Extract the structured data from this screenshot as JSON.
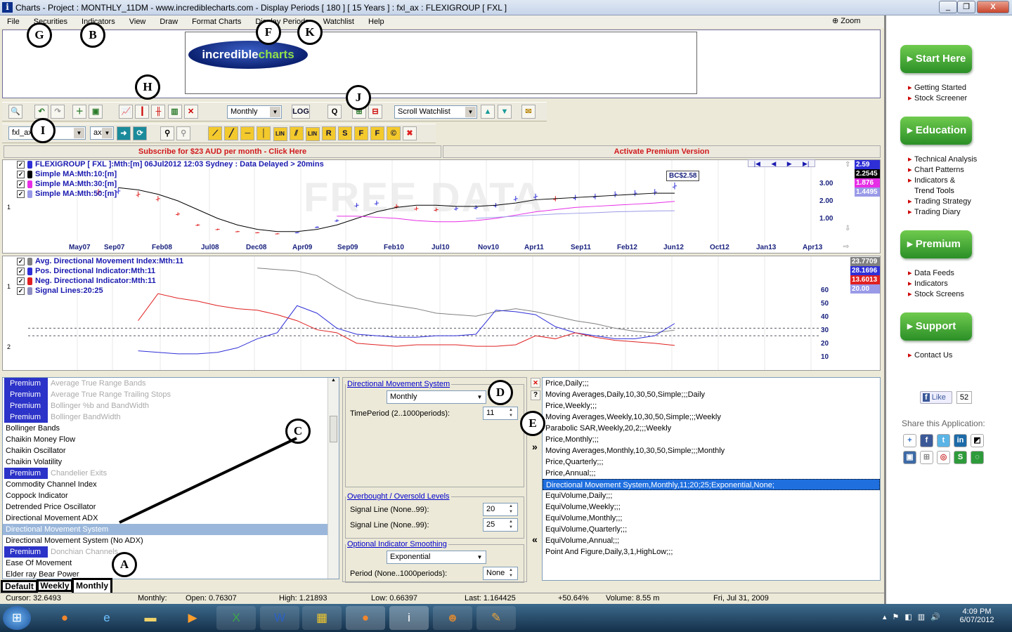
{
  "window": {
    "title": "Charts - Project : MONTHLY_11DM - www.incrediblecharts.com - Display Periods  [ 180 ]  [ 15 Years ] : fxl_ax : FLEXIGROUP  [ FXL ]",
    "icon_glyph": "i",
    "min": "_",
    "max": "❐",
    "close": "X"
  },
  "menu": {
    "items": [
      "File",
      "Securities",
      "Indicators",
      "View",
      "Draw",
      "Format Charts",
      "Display Periods",
      "Watchlist",
      "Help"
    ],
    "zoom": "Zoom"
  },
  "logo": {
    "left": "incredible",
    "right": "charts"
  },
  "toolbar1": {
    "period": "Monthly",
    "log": "LOG",
    "watchlist": "Scroll Watchlist"
  },
  "toolbar2": {
    "symbol": "fxl_ax",
    "exchange": "ax"
  },
  "banners": {
    "subscribe": "Subscribe for $23 AUD per month - Click Here",
    "activate": "Activate Premium Version"
  },
  "price_chart": {
    "watermark": "FREE DATA",
    "legend": [
      {
        "text": "FLEXIGROUP [ FXL ]:Mth:[m]  06Jul2012 12:03 Sydney : Data Delayed > 20mins",
        "color": "#2f2fd8"
      },
      {
        "text": "Simple MA:Mth:10:[m]",
        "color": "#000000"
      },
      {
        "text": "Simple MA:Mth:30:[m]",
        "color": "#e62ee6"
      },
      {
        "text": "Simple MA:Mth:50:[m]",
        "color": "#9a9ae8"
      }
    ],
    "badges": [
      {
        "v": "2.59",
        "c": "#2f2fd8"
      },
      {
        "v": "2.2545",
        "c": "#000000"
      },
      {
        "v": "1.876",
        "c": "#e62ee6"
      },
      {
        "v": "1.4495",
        "c": "#9a9ae8"
      }
    ],
    "callout": "BC$2.58",
    "pane_num": "1",
    "x_labels": [
      "May07",
      "Sep07",
      "Feb08",
      "Jul08",
      "Dec08",
      "Apr09",
      "Sep09",
      "Feb10",
      "Jul10",
      "Nov10",
      "Apr11",
      "Sep11",
      "Feb12",
      "Jun12",
      "Oct12",
      "Jan13",
      "Apr13"
    ],
    "y_labels": [
      "3.00",
      "2.00",
      "1.00"
    ],
    "nav": [
      "|◀",
      "◀",
      "▶",
      "▶|"
    ]
  },
  "dmi_chart": {
    "legend": [
      {
        "text": "Avg. Directional Movement Index:Mth:11",
        "color": "#808080"
      },
      {
        "text": "Pos. Directional Indicator:Mth:11",
        "color": "#2f2fd8"
      },
      {
        "text": "Neg. Directional Indicator:Mth:11",
        "color": "#e02020"
      },
      {
        "text": "Signal Lines:20:25",
        "color": "#8d8dbf"
      }
    ],
    "badges": [
      {
        "v": "23.7709",
        "c": "#808080"
      },
      {
        "v": "28.1696",
        "c": "#2f2fd8"
      },
      {
        "v": "13.6013",
        "c": "#e02020"
      },
      {
        "v": "20.00",
        "c": "#9a9ae8"
      }
    ],
    "pane_nums": [
      "1",
      "2"
    ],
    "y_labels": [
      "60",
      "50",
      "40",
      "30",
      "20",
      "10"
    ]
  },
  "chart_data": {
    "type": "line",
    "title": "FLEXIGROUP [ FXL ]",
    "x_ticks": [
      "May07",
      "Sep07",
      "Feb08",
      "Jul08",
      "Dec08",
      "Apr09",
      "Sep09",
      "Feb10",
      "Jul10",
      "Nov10",
      "Apr11",
      "Sep11",
      "Feb12",
      "Jun12",
      "Oct12",
      "Jan13",
      "Apr13"
    ],
    "price_ylim": [
      0.3,
      3.5
    ],
    "price_series": [
      {
        "name": "Price",
        "values": [
          2.3,
          2.35,
          2.2,
          2.0,
          1.3,
          0.8,
          0.6,
          0.5,
          0.45,
          0.4,
          0.45,
          0.7,
          1.0,
          1.7,
          1.8,
          1.65,
          1.55,
          1.5,
          1.55,
          1.6,
          1.7,
          2.0,
          2.1,
          2.0,
          2.05,
          2.1,
          2.2,
          2.25,
          2.3,
          2.58
        ]
      },
      {
        "name": "Simple MA:Mth:10",
        "values": [
          null,
          2.5,
          2.4,
          2.2,
          1.9,
          1.5,
          1.1,
          0.8,
          0.6,
          0.5,
          0.5,
          0.6,
          0.8,
          1.1,
          1.4,
          1.6,
          1.7,
          1.7,
          1.65,
          1.65,
          1.7,
          1.8,
          1.95,
          2.0,
          2.05,
          2.1,
          2.15,
          2.2,
          2.25,
          2.25
        ]
      },
      {
        "name": "Simple MA:Mth:30",
        "values": [
          null,
          null,
          null,
          null,
          null,
          null,
          null,
          null,
          null,
          null,
          null,
          null,
          1.2,
          1.2,
          1.15,
          1.1,
          1.0,
          0.95,
          0.95,
          1.0,
          1.1,
          1.25,
          1.4,
          1.5,
          1.6,
          1.65,
          1.7,
          1.75,
          1.8,
          1.876
        ]
      },
      {
        "name": "Simple MA:Mth:50",
        "values": [
          null,
          null,
          null,
          null,
          null,
          null,
          null,
          null,
          null,
          null,
          null,
          null,
          null,
          null,
          null,
          null,
          null,
          null,
          null,
          1.1,
          1.15,
          1.2,
          1.25,
          1.3,
          1.33,
          1.36,
          1.4,
          1.42,
          1.44,
          1.4495
        ]
      }
    ],
    "dmi_ylim": [
      0,
      70
    ],
    "dmi_series": [
      {
        "name": "ADX",
        "values": [
          null,
          null,
          null,
          null,
          null,
          null,
          null,
          null,
          65,
          64,
          63,
          60,
          52,
          45,
          42,
          40,
          38,
          35,
          34,
          33,
          36,
          38,
          36,
          33,
          30,
          28,
          25,
          23,
          22,
          23.77
        ]
      },
      {
        "name": "+DI",
        "values": [
          null,
          null,
          10,
          9,
          8,
          8,
          9,
          12,
          18,
          22,
          40,
          35,
          25,
          21,
          20,
          19,
          19,
          20,
          20,
          21,
          37,
          36,
          34,
          26,
          22,
          20,
          18,
          18,
          20,
          28.17
        ]
      },
      {
        "name": "-DI",
        "values": [
          null,
          null,
          30,
          48,
          45,
          43,
          40,
          38,
          37,
          34,
          30,
          24,
          22,
          15,
          14,
          13,
          14,
          14,
          14,
          13,
          13,
          14,
          20,
          18,
          22,
          19,
          17,
          16,
          15,
          13.6
        ]
      }
    ],
    "signal_lines": [
      20,
      25
    ]
  },
  "indicator_list": {
    "items": [
      {
        "label": "Average True Range Bands",
        "premium": true
      },
      {
        "label": "Average True Range Trailing Stops",
        "premium": true
      },
      {
        "label": "Bollinger %b and BandWidth",
        "premium": true
      },
      {
        "label": "Bollinger BandWidth",
        "premium": true
      },
      {
        "label": "Bollinger Bands",
        "premium": false
      },
      {
        "label": "Chaikin Money Flow",
        "premium": false
      },
      {
        "label": "Chaikin Oscillator",
        "premium": false
      },
      {
        "label": "Chaikin Volatility",
        "premium": false
      },
      {
        "label": "Chandelier Exits",
        "premium": true
      },
      {
        "label": "Commodity Channel Index",
        "premium": false
      },
      {
        "label": "Coppock Indicator",
        "premium": false
      },
      {
        "label": "Detrended Price Oscillator",
        "premium": false
      },
      {
        "label": "Directional Movement ADX",
        "premium": false
      },
      {
        "label": "Directional Movement System",
        "premium": false,
        "selected": true
      },
      {
        "label": "Directional Movement System (No ADX)",
        "premium": false
      },
      {
        "label": "Donchian Channels",
        "premium": true
      },
      {
        "label": "Ease Of Movement",
        "premium": false
      },
      {
        "label": "Elder ray Bear Power",
        "premium": false
      }
    ],
    "premium_label": "Premium"
  },
  "settings": {
    "group1": "Directional Movement System",
    "period": "Monthly",
    "tp_label": "TimePeriod (2..1000periods):",
    "tp_value": "11",
    "group2": "Overbought / Oversold Levels",
    "sl1_label": "Signal Line (None..99):",
    "sl1_value": "20",
    "sl2_label": "Signal Line (None..99):",
    "sl2_value": "25",
    "group3": "Optional Indicator Smoothing",
    "smooth": "Exponential",
    "per_label": "Period (None..1000periods):",
    "per_value": "None",
    "close_x": "✕",
    "help": "?",
    "add": "»",
    "remove": "«"
  },
  "rules": {
    "items": [
      "Price,Daily;;;",
      "Moving Averages,Daily,10,30,50,Simple;;;Daily",
      "Price,Weekly;;;",
      "Moving Averages,Weekly,10,30,50,Simple;;;Weekly",
      "Parabolic SAR,Weekly,20,2;;;Weekly",
      "Price,Monthly;;;",
      "Moving Averages,Monthly,10,30,50,Simple;;;Monthly",
      "Price,Quarterly;;;",
      "Price,Annual;;;",
      "Directional Movement System,Monthly,11;20;25;Exponential,None;",
      "EquiVolume,Daily;;;",
      "EquiVolume,Weekly;;;",
      "EquiVolume,Monthly;;;",
      "EquiVolume,Quarterly;;;",
      "EquiVolume,Annual;;;",
      "Point And Figure,Daily,3,1,HighLow;;;"
    ],
    "selected": 9
  },
  "tabs": {
    "default": "Default",
    "weekly": "Weekly",
    "monthly": "Monthly"
  },
  "status": {
    "cursor": "Cursor: 32.6493",
    "period": "Monthly:",
    "open": "Open: 0.76307",
    "high": "High: 1.21893",
    "low": "Low: 0.66397",
    "last": "Last: 1.164425",
    "change": "+50.64%",
    "volume": "Volume: 8.55 m",
    "date": "Fri, Jul 31, 2009"
  },
  "sidebar": {
    "start": "▸ Start Here",
    "start_links": [
      "Getting Started",
      "Stock Screener"
    ],
    "education": "▸ Education",
    "edu_links": [
      "Technical Analysis",
      "Chart Patterns",
      "Indicators &",
      "Trend Tools",
      "Trading Strategy",
      "Trading Diary"
    ],
    "premium": "▸ Premium",
    "prem_links": [
      "Data Feeds",
      "Indicators",
      "Stock Screens"
    ],
    "support": "▸ Support",
    "sup_links": [
      "Contact Us"
    ],
    "like": "Like",
    "like_count": "52",
    "share": "Share this Application:"
  },
  "taskbar": {
    "time": "4:09 PM",
    "date": "6/07/2012"
  },
  "markers": [
    "G",
    "B",
    "H",
    "F",
    "K",
    "J",
    "I",
    "C",
    "D",
    "E",
    "A"
  ]
}
